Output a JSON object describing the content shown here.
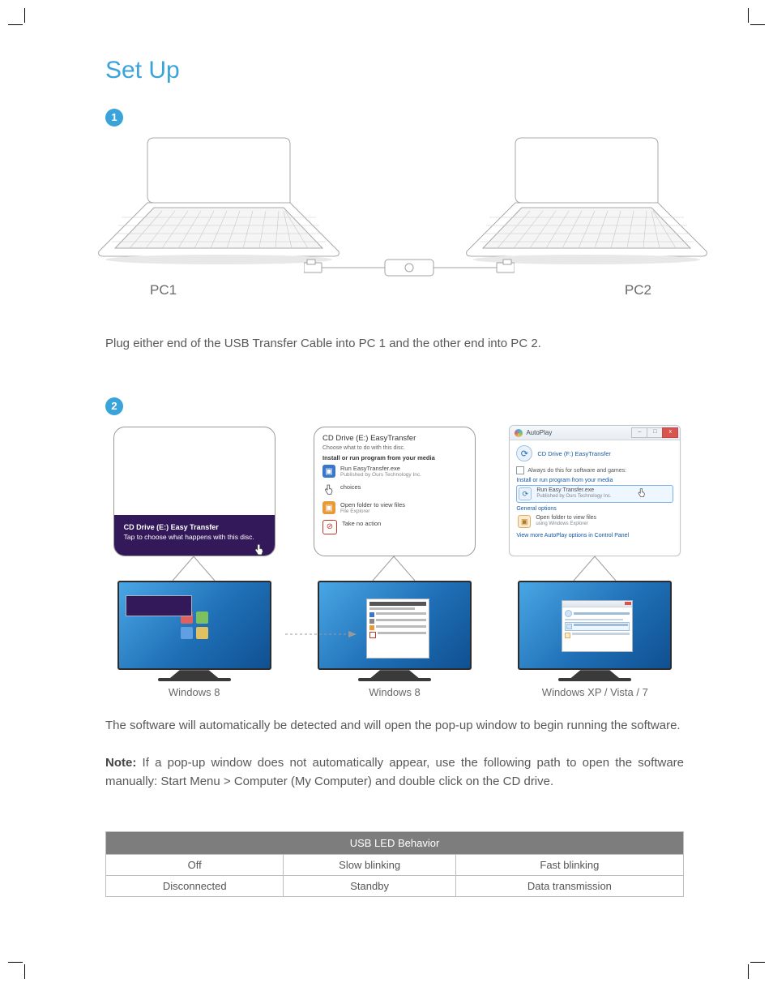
{
  "title": "Set Up",
  "step1": {
    "badge": "1",
    "pc1": "PC1",
    "pc2": "PC2",
    "caption": "Plug either end of the USB Transfer Cable into PC 1 and the other end into PC 2."
  },
  "step2": {
    "badge": "2",
    "col1": {
      "toast_title": "CD Drive (E:) Easy Transfer",
      "toast_sub": "Tap to choose what happens with this disc.",
      "os": "Windows 8"
    },
    "col2": {
      "header": "CD Drive (E:) EasyTransfer",
      "sub": "Choose what to do with this disc.",
      "section": "Install or run program from your media",
      "opt1": "Run EasyTransfer.exe",
      "opt1_sub": "Published by Ours Technology Inc.",
      "opt2_label": "choices",
      "opt3": "Open folder to view files",
      "opt3_sub": "File Explorer",
      "opt4": "Take no action",
      "os": "Windows 8"
    },
    "col3": {
      "title": "AutoPlay",
      "drive": "CD Drive (F:) EasyTransfer",
      "always": "Always do this for software and games:",
      "grp1": "Install or run program from your media",
      "run": "Run Easy Transfer.exe",
      "run_sub": "Published by Ours Technology Inc.",
      "grp2": "General options",
      "open": "Open folder to view files",
      "open_sub": "using Windows Explorer",
      "more": "View more AutoPlay options in Control Panel",
      "os": "Windows XP / Vista / 7"
    },
    "body": "The software will automatically be detected and will open the pop-up window to begin running the software.",
    "note_label": "Note:",
    "note_body": " If a pop-up window does not automatically appear, use the following path to open the software manually: Start Menu > Computer (My Computer) and double click on the CD drive."
  },
  "table": {
    "header": "USB LED Behavior",
    "r1c1": "Off",
    "r1c2": "Slow blinking",
    "r1c3": "Fast blinking",
    "r2c1": "Disconnected",
    "r2c2": "Standby",
    "r2c3": "Data transmission"
  }
}
